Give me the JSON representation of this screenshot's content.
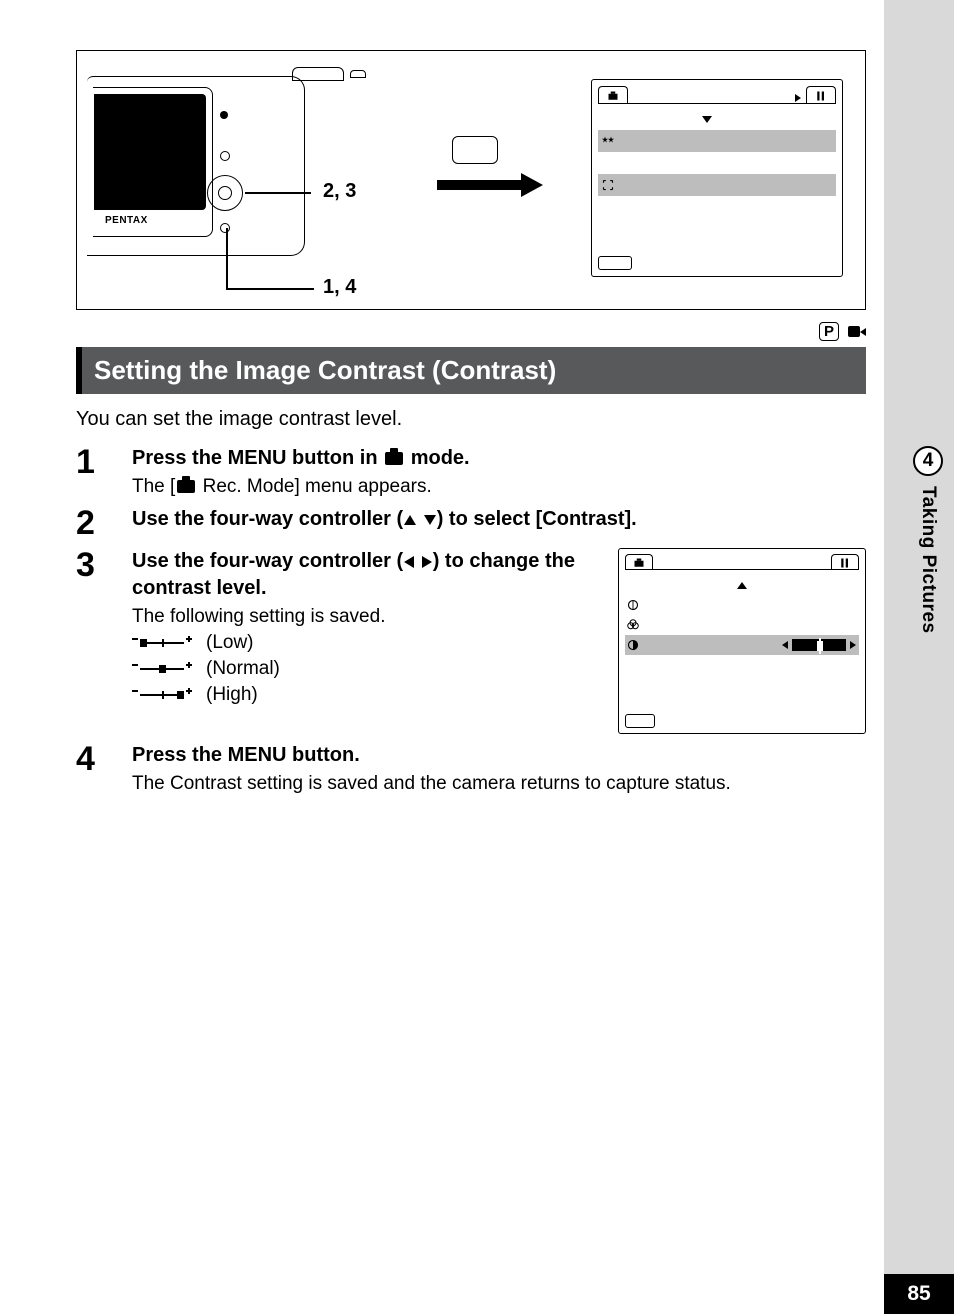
{
  "sidebar": {
    "chapter_num": "4",
    "chapter_title": "Taking Pictures"
  },
  "page_number": "85",
  "illus": {
    "brand": "PENTAX",
    "label_top": "2, 3",
    "label_bottom": "1, 4"
  },
  "mode_badge_p": "P",
  "heading": "Setting the Image Contrast (Contrast)",
  "intro": "You can set the image contrast level.",
  "steps": {
    "s1": {
      "num": "1",
      "title_a": "Press the ",
      "title_menu": "MENU",
      "title_b": " button in ",
      "title_c": " mode.",
      "desc_a": "The [",
      "desc_b": " Rec. Mode] menu appears."
    },
    "s2": {
      "num": "2",
      "title_a": "Use the four-way controller (",
      "title_b": ") to select [Contrast]."
    },
    "s3": {
      "num": "3",
      "title_a": "Use the four-way controller (",
      "title_b": ") to change the contrast level.",
      "desc": "The following setting is saved.",
      "low": "(Low)",
      "normal": "(Normal)",
      "high": "(High)"
    },
    "s4": {
      "num": "4",
      "title_a": "Press the ",
      "title_menu": "MENU",
      "title_b": " button.",
      "desc": "The Contrast setting is saved and the camera returns to capture status."
    }
  }
}
